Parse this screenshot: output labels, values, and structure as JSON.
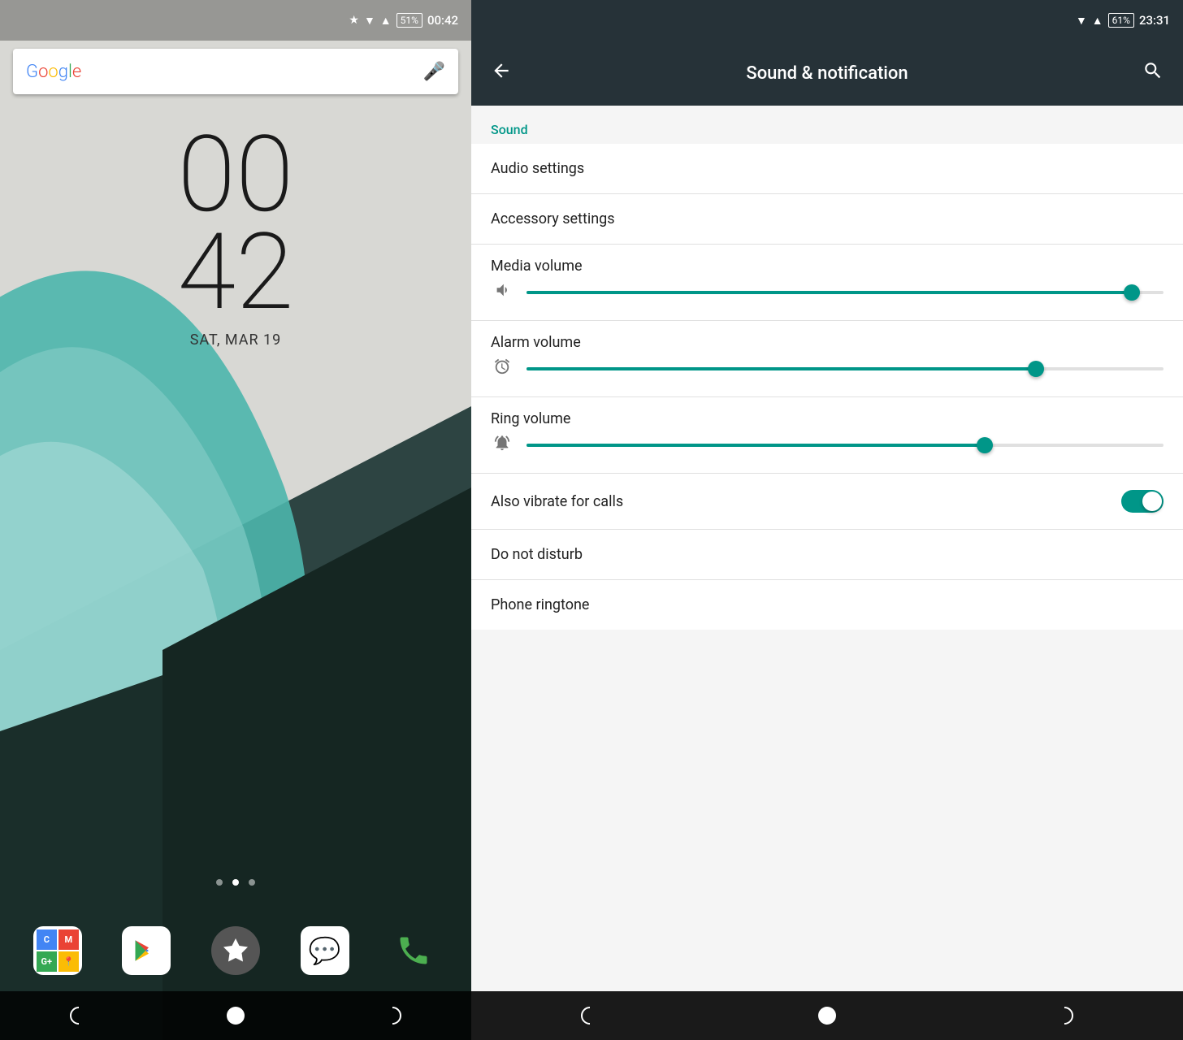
{
  "left": {
    "status": {
      "battery": "51%",
      "time": "00:42"
    },
    "google_bar": {
      "text": "Google",
      "mic_label": "microphone"
    },
    "clock": {
      "hours": "00",
      "minutes": "42",
      "date": "SAT, MAR 19"
    },
    "dots": [
      false,
      true,
      false
    ],
    "nav": {
      "back": "◐",
      "home": "●",
      "recents": "◑"
    }
  },
  "right": {
    "status": {
      "battery": "61%",
      "time": "23:31"
    },
    "header": {
      "title": "Sound & notification",
      "back_label": "back",
      "search_label": "search"
    },
    "section_sound": "Sound",
    "items": [
      {
        "id": "audio-settings",
        "label": "Audio settings",
        "type": "link"
      },
      {
        "id": "accessory-settings",
        "label": "Accessory settings",
        "type": "link"
      },
      {
        "id": "media-volume",
        "label": "Media volume",
        "type": "slider",
        "value": 95,
        "icon": "🔉"
      },
      {
        "id": "alarm-volume",
        "label": "Alarm volume",
        "type": "slider",
        "value": 80,
        "icon": "⏰"
      },
      {
        "id": "ring-volume",
        "label": "Ring volume",
        "type": "slider",
        "value": 72,
        "icon": "🔔"
      },
      {
        "id": "also-vibrate",
        "label": "Also vibrate for calls",
        "type": "toggle",
        "value": true
      },
      {
        "id": "do-not-disturb",
        "label": "Do not disturb",
        "type": "link"
      },
      {
        "id": "phone-ringtone",
        "label": "Phone ringtone",
        "type": "link"
      }
    ],
    "nav": {
      "back": "◐",
      "home": "●",
      "recents": "◑"
    }
  }
}
